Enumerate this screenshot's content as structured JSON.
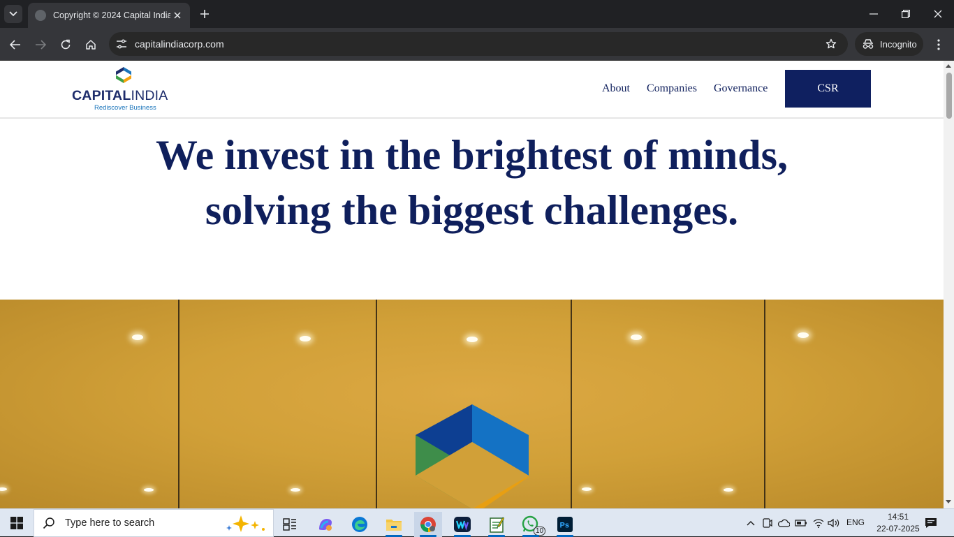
{
  "browser": {
    "tab_title": "Copyright © 2024 Capital India",
    "url": "capitalindiacorp.com",
    "incognito_label": "Incognito"
  },
  "site": {
    "logo": {
      "brand_bold": "CAPITAL",
      "brand_regular": "INDIA",
      "tagline": "Rediscover Business"
    },
    "nav": [
      {
        "label": "About"
      },
      {
        "label": "Companies"
      },
      {
        "label": "Governance"
      }
    ],
    "cta_label": "CSR",
    "hero_heading": "We invest in the brightest of minds, solving the biggest challenges."
  },
  "taskbar": {
    "search_placeholder": "Type here to search",
    "whatsapp_badge": "10",
    "language": "ENG",
    "time": "14:51",
    "date": "22-07-2025"
  },
  "colors": {
    "brand_navy": "#0f1f5c",
    "cta_background": "#0f2060",
    "logo_blue": "#1b75bb",
    "logo_green": "#3ea04a",
    "logo_orange": "#f5a10d",
    "wall_gold": "#d1a038"
  },
  "icons": [
    "tab-search-icon",
    "close-icon",
    "plus-icon",
    "minimize-icon",
    "restore-icon",
    "back-icon",
    "forward-icon",
    "reload-icon",
    "home-icon",
    "site-info-icon",
    "star-icon",
    "incognito-icon",
    "kebab-menu-icon",
    "windows-icon",
    "search-icon",
    "task-view-icon",
    "copilot-icon",
    "edge-icon",
    "file-explorer-icon",
    "chrome-icon",
    "webex-icon",
    "notepad-icon",
    "whatsapp-icon",
    "photoshop-icon",
    "notification-icon"
  ]
}
